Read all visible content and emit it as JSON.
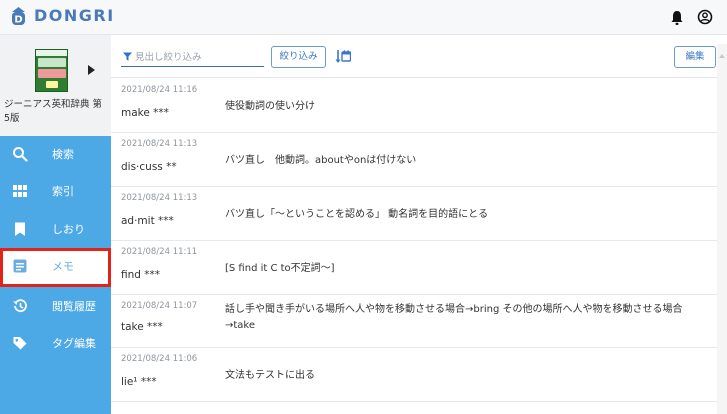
{
  "header": {
    "logo_text": "DONGRI",
    "logo_icon": "d-logo-icon",
    "notification_icon": "bell-icon",
    "account_icon": "account-icon"
  },
  "sidebar": {
    "book": {
      "title": "ジーニアス英和辞典 第5版",
      "cover_text": "GENIUS シーニアス 英和辞典 G5",
      "arrow_icon": "play-arrow-icon"
    },
    "items": [
      {
        "label": "検索",
        "icon": "search-icon"
      },
      {
        "label": "索引",
        "icon": "grid-icon"
      },
      {
        "label": "しおり",
        "icon": "bookmark-icon"
      },
      {
        "label": "メモ",
        "icon": "memo-icon",
        "selected": true
      },
      {
        "label": "閲覧履歴",
        "icon": "history-icon"
      },
      {
        "label": "タグ編集",
        "icon": "tag-icon"
      }
    ]
  },
  "toolbar": {
    "filter_placeholder": "見出し絞り込み",
    "filter_value": "",
    "filter_button": "絞り込み",
    "sort_icon": "sort-calendar-icon",
    "edit_button": "編集"
  },
  "memos": [
    {
      "timestamp": "2021/08/24 11:16",
      "headword": "make ***",
      "memo": "使役動詞の使い分け"
    },
    {
      "timestamp": "2021/08/24 11:13",
      "headword": "dis·cuss **",
      "memo": "バツ直し　他動詞。aboutやonは付けない"
    },
    {
      "timestamp": "2021/08/24 11:13",
      "headword": "ad·mit ***",
      "memo": "バツ直し「～ということを認める」 動名詞を目的語にとる"
    },
    {
      "timestamp": "2021/08/24 11:11",
      "headword": "find ***",
      "memo": "[S find it C to不定詞～]"
    },
    {
      "timestamp": "2021/08/24 11:07",
      "headword": "take ***",
      "memo": "話し手や聞き手がいる場所へ人や物を移動させる場合→bring その他の場所へ人や物を移動させる場合→take"
    },
    {
      "timestamp": "2021/08/24 11:06",
      "headword": "lie¹ ***",
      "memo": "文法もテストに出る"
    }
  ],
  "colors": {
    "sidebar_bg": "#4da8e6",
    "accent": "#3b77c4",
    "selection_border": "#e32219"
  }
}
